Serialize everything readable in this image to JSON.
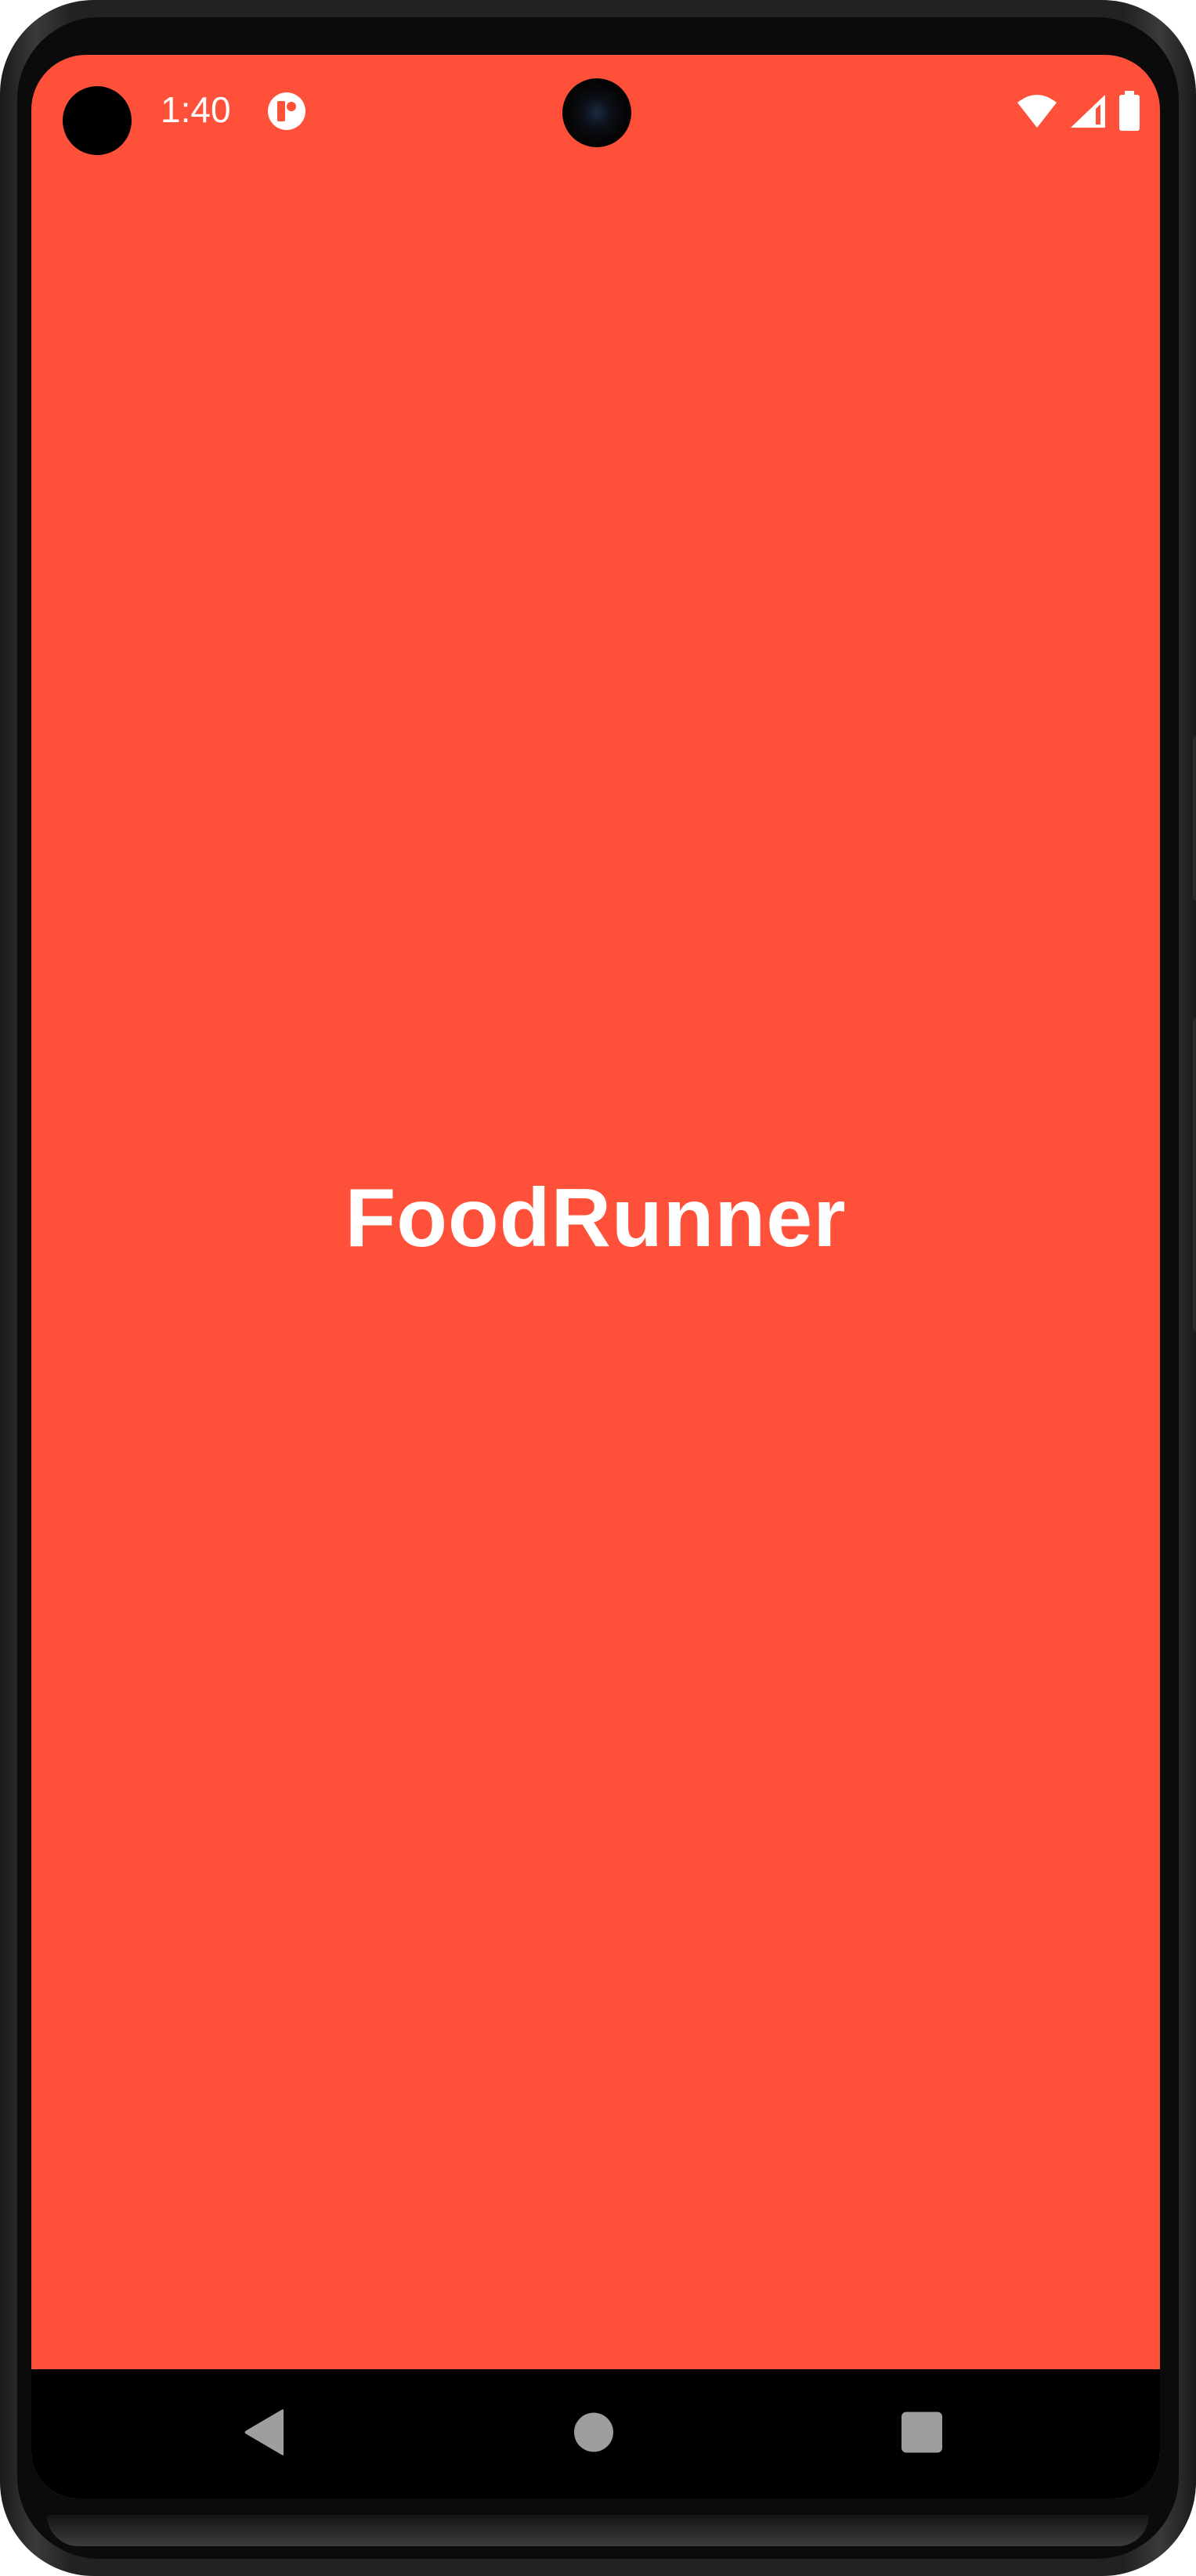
{
  "status_bar": {
    "time": "1:40",
    "notification_icon": "app-notification-icon",
    "wifi_icon": "wifi-icon",
    "signal_icon": "cell-signal-icon",
    "battery_icon": "battery-icon"
  },
  "splash": {
    "app_name": "FoodRunner",
    "background_color": "#FF5039",
    "text_color": "#FFFFFF"
  },
  "nav_bar": {
    "back_icon": "back-triangle-icon",
    "home_icon": "home-circle-icon",
    "recents_icon": "recents-square-icon",
    "icon_color": "#9E9E9E"
  }
}
